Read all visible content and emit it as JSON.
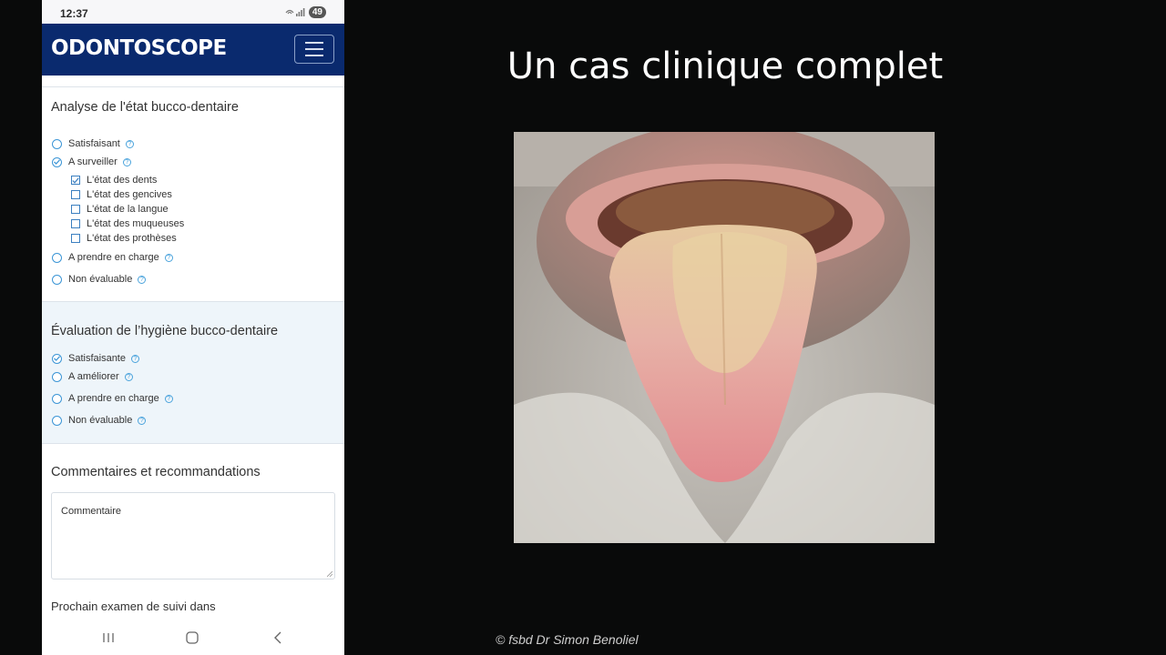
{
  "status_bar": {
    "time": "12:37",
    "battery": "49"
  },
  "app": {
    "logo": "ODONTOSCOPE"
  },
  "oral_state": {
    "title": "Analyse de l'état bucco-dentaire",
    "options": [
      "Satisfaisant",
      "A surveiller",
      "A prendre en charge",
      "Non évaluable"
    ],
    "selected": "A surveiller",
    "sub_items": [
      {
        "label": "L'état des dents",
        "checked": true
      },
      {
        "label": "L'état des gencives",
        "checked": false
      },
      {
        "label": "L'état de la langue",
        "checked": false
      },
      {
        "label": "L'état des muqueuses",
        "checked": false
      },
      {
        "label": "L'état des prothèses",
        "checked": false
      }
    ]
  },
  "hygiene": {
    "title": "Évaluation de l’hygiène bucco-dentaire",
    "options": [
      "Satisfaisante",
      "A améliorer",
      "A prendre en charge",
      "Non évaluable"
    ],
    "selected": "Satisfaisante"
  },
  "comments": {
    "title": "Commentaires et recommandations",
    "placeholder": "Commentaire"
  },
  "next_exam": {
    "label": "Prochain examen de suivi dans"
  },
  "slide": {
    "title": "Un cas clinique complet",
    "credit": "© fsbd Dr Simon Benoliel"
  },
  "colors": {
    "app_bar": "#0a2a6e",
    "accent": "#3b95d6",
    "slide_bg": "#090a0a"
  }
}
